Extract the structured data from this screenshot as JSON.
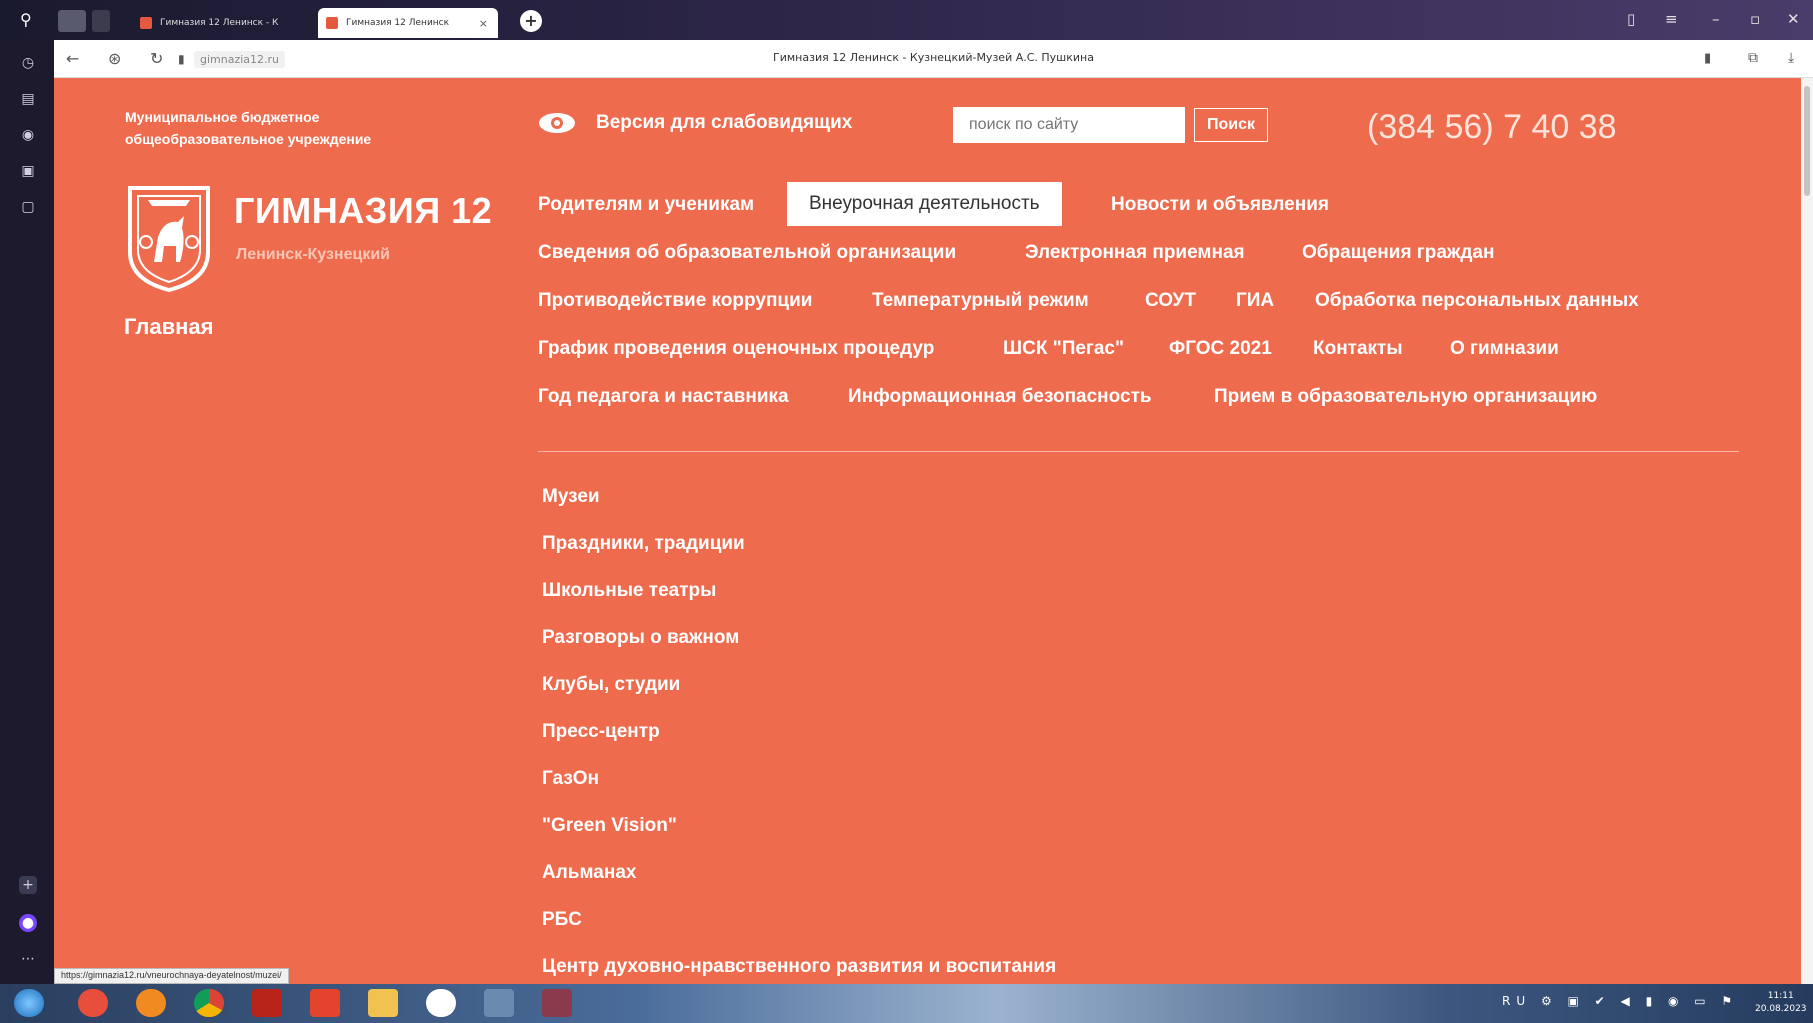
{
  "browser": {
    "tabs": [
      {
        "title": "Гимназия 12 Ленинск - К"
      },
      {
        "title": "Гимназия 12 Ленинск",
        "close": "×"
      }
    ],
    "new_tab_symbol": "+",
    "url": "gimnazia12.ru",
    "page_title": "Гимназия 12 Ленинск - Кузнецкий-Музей А.С. Пушкина",
    "status_url": "https://gimnazia12.ru/vneurochnaya-deyatelnost/muzei/"
  },
  "header": {
    "org_type": "Муниципальное бюджетное общеобразовательное учреждение",
    "school_name": "ГИМНАЗИЯ 12",
    "city": "Ленинск-Кузнецкий",
    "home": "Главная",
    "low_vision_label": "Версия для слабовидящих",
    "search": {
      "placeholder": "поиск по сайту",
      "button": "Поиск"
    },
    "phone": "(384 56) 7 40 38"
  },
  "menu": {
    "rows": [
      [
        "Родителям и ученикам",
        "Внеурочная деятельность",
        "Новости и объявления"
      ],
      [
        "Сведения об образовательной организации",
        "Электронная приемная",
        "Обращения граждан"
      ],
      [
        "Противодействие коррупции",
        "Температурный режим",
        "СОУТ",
        "ГИА",
        "Обработка персональных данных"
      ],
      [
        "График проведения оценочных процедур",
        "ШСК \"Пегас\"",
        "ФГОС 2021",
        "Контакты",
        "О гимназии"
      ],
      [
        "Год педагога и наставника",
        "Информационная безопасность",
        "Прием в образовательную организацию"
      ]
    ],
    "active": "Внеурочная деятельность"
  },
  "submenu": [
    "Музеи",
    "Праздники, традиции",
    "Школьные театры",
    "Разговоры о важном",
    "Клубы, студии",
    "Пресс-центр",
    "ГазОн",
    "\"Green Vision\"",
    "Альманах",
    "РБС",
    "Центр духовно-нравственного развития и воспитания"
  ],
  "taskbar": {
    "time": "11:11",
    "date": "20.08.2023",
    "lang": "RU"
  },
  "colors": {
    "page_bg": "#ef6b4e",
    "accent_white": "#ffffff"
  }
}
